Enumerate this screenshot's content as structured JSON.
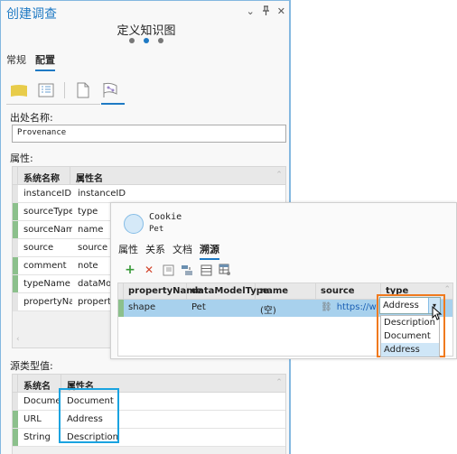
{
  "pane": {
    "title": "创建调查",
    "controls": {
      "menu": "⌄",
      "pin": "ᵖ",
      "close": "✕"
    },
    "step_title": "定义知识图",
    "steps": {
      "total": 3,
      "current": 2
    },
    "tabs": [
      {
        "label": "常规",
        "active": false
      },
      {
        "label": "配置",
        "active": true
      }
    ],
    "icons": [
      "entity-type-icon",
      "properties-icon",
      "document-icon",
      "provenance-icon"
    ],
    "provenance_label": "出处名称:",
    "provenance_value": "Provenance",
    "attributes_label": "属性:",
    "attributes": {
      "columns": [
        "系统名称",
        "属性名"
      ],
      "rows": [
        {
          "system": "instanceID",
          "attr": "instanceID",
          "green": false
        },
        {
          "system": "sourceType",
          "attr": "type",
          "green": true
        },
        {
          "system": "sourceName",
          "attr": "name",
          "green": true
        },
        {
          "system": "source",
          "attr": "source",
          "green": false
        },
        {
          "system": "comment",
          "attr": "note",
          "green": true
        },
        {
          "system": "typeName",
          "attr": "dataModelType",
          "green": true
        },
        {
          "system": "propertyName",
          "attr": "propertyName",
          "green": false
        }
      ]
    },
    "source_type_label": "源类型值:",
    "source_types": {
      "columns": [
        "系统名称",
        "属性名"
      ],
      "rows": [
        {
          "system": "Document",
          "attr": "Document",
          "green": false
        },
        {
          "system": "URL",
          "attr": "Address",
          "green": true
        },
        {
          "system": "String",
          "attr": "Description",
          "green": true
        }
      ]
    }
  },
  "popup": {
    "entity_name": "Cookie",
    "entity_type": "Pet",
    "tabs": [
      {
        "label": "属性",
        "active": false
      },
      {
        "label": "关系",
        "active": false
      },
      {
        "label": "文档",
        "active": false
      },
      {
        "label": "溯源",
        "active": true
      }
    ],
    "tools": [
      "add-icon",
      "delete-icon",
      "edit-icon",
      "move-icon",
      "list-icon",
      "table-settings-icon"
    ],
    "grid": {
      "columns": [
        "propertyName",
        "dataModelType",
        "name",
        "source",
        "type"
      ],
      "row": {
        "propertyName": "shape",
        "dataModelType": "Pet",
        "name": "(空)",
        "source": "https://w'''",
        "type": "Address"
      }
    },
    "type_options": [
      "Description",
      "Document",
      "Address"
    ],
    "selected_type": "Address"
  },
  "colors": {
    "accent": "#1f7ac4",
    "highlight_orange": "#f07a1e",
    "highlight_blue": "#1aa3e0",
    "row_selected": "#a8d1ed",
    "indicator_green": "#8cc08c"
  }
}
